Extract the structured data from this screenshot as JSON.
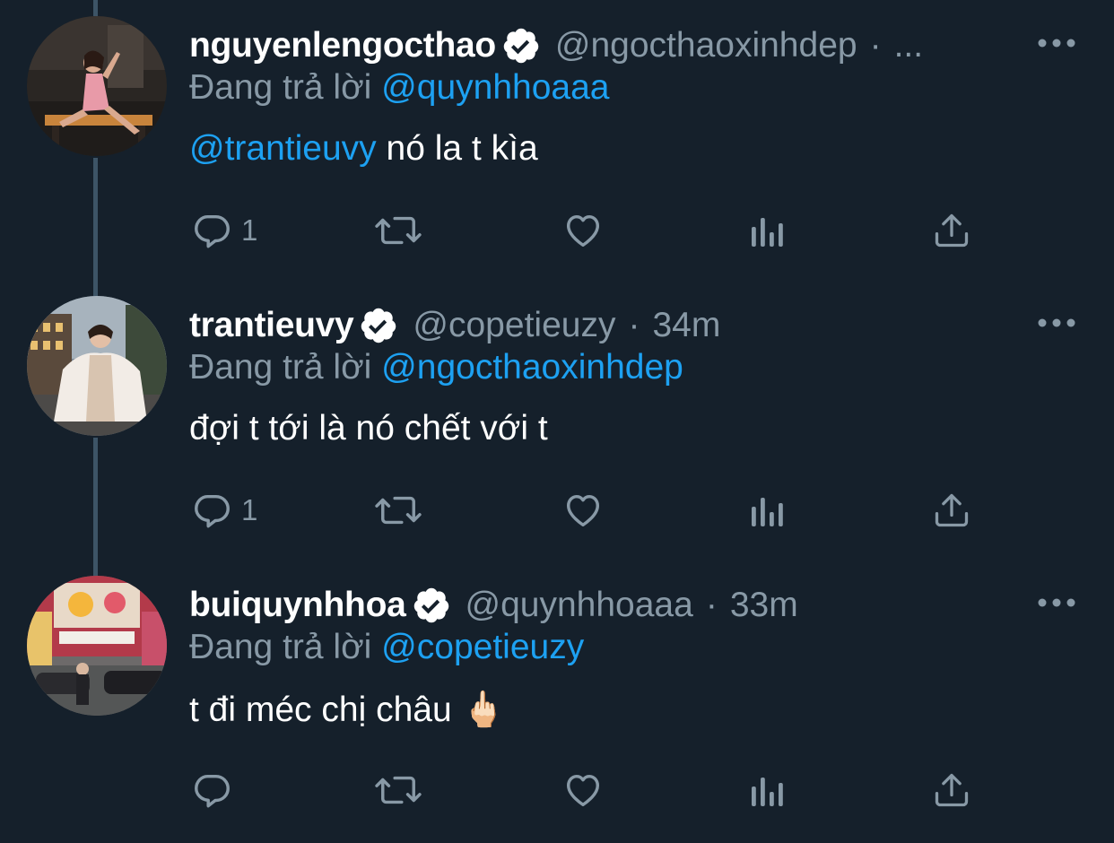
{
  "tweets": [
    {
      "display_name": "nguyenlengocthao",
      "handle": "@ngocthaoxinhdep",
      "separator": "·",
      "time": "...",
      "reply_prefix": "Đang trả lời",
      "reply_mention": "@quynhhoaaa",
      "text_mention": "@trantieuvy",
      "text": "nó la t kìa",
      "reply_count": "1",
      "verified": true
    },
    {
      "display_name": "trantieuvy",
      "handle": "@copetieuzy",
      "separator": "·",
      "time": "34m",
      "reply_prefix": "Đang trả lời",
      "reply_mention": "@ngocthaoxinhdep",
      "text_mention": "",
      "text": "đợi t tới là nó chết với t",
      "reply_count": "1",
      "verified": true
    },
    {
      "display_name": "buiquynhhoa",
      "handle": "@quynhhoaaa",
      "separator": "·",
      "time": "33m",
      "reply_prefix": "Đang trả lời",
      "reply_mention": "@copetieuzy",
      "text_mention": "",
      "text": "t đi méc chị châu 🖕🏻",
      "reply_count": "",
      "verified": true
    }
  ],
  "icons": {
    "reply": "reply-icon",
    "retweet": "retweet-icon",
    "like": "like-icon",
    "analytics": "analytics-icon",
    "share": "share-icon",
    "more": "more-icon",
    "verified": "verified-badge-icon"
  },
  "colors": {
    "background": "#15202b",
    "thread_line": "#3d5466",
    "link": "#1da1f2",
    "muted": "#8899a6",
    "text": "#ffffff"
  }
}
